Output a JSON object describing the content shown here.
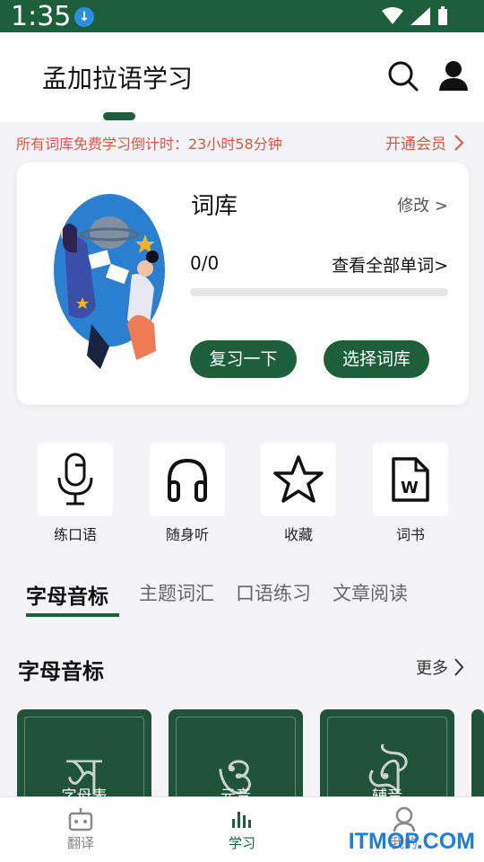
{
  "status": {
    "time": "1:35"
  },
  "header": {
    "title": "孟加拉语学习"
  },
  "promo": {
    "text": "所有词库免费学习倒计时：23小时58分钟",
    "vip": "开通会员"
  },
  "card": {
    "title": "词库",
    "edit": "修改 >",
    "count": "0/0",
    "view_all": "查看全部单词>",
    "progress": 0,
    "review": "复习一下",
    "select": "选择词库"
  },
  "features": [
    {
      "label": "练口语",
      "icon": "microphone-icon"
    },
    {
      "label": "随身听",
      "icon": "headphones-icon"
    },
    {
      "label": "收藏",
      "icon": "star-icon"
    },
    {
      "label": "词书",
      "icon": "document-icon"
    }
  ],
  "tabs": [
    "字母音标",
    "主题词汇",
    "口语练习",
    "文章阅读"
  ],
  "section": {
    "title": "字母音标",
    "more": "更多"
  },
  "tiles": [
    {
      "label": "字母表",
      "glyph": "স"
    },
    {
      "label": "元音",
      "glyph": "ও"
    },
    {
      "label": "辅音",
      "glyph": "ঐ"
    }
  ],
  "bottom_nav": [
    {
      "label": "翻译",
      "icon": "robot-icon"
    },
    {
      "label": "学习",
      "icon": "bars-icon"
    },
    {
      "label": "我的",
      "icon": "person-icon"
    }
  ],
  "watermark": "ITMOP.COM",
  "colors": {
    "brand": "#1e5f3b",
    "promo": "#e05548"
  }
}
